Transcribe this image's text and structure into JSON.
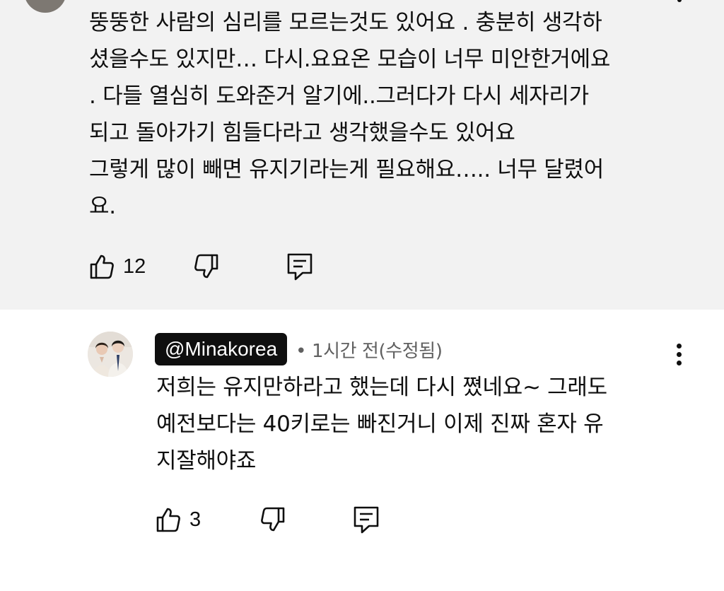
{
  "top_comment": {
    "lines": [
      "뚱뚱한 사람의 심리를 모르는것도 있어요 . 충분히 생각하",
      "셨을수도 있지만… 다시.요요온 모습이 너무 미안한거에요",
      ". 다들 열심히 도와준거 알기에..그러다가 다시 세자리가",
      "되고 돌아가기 힘들다라고 생각했을수도 있어요",
      "그렇게 많이 빼면 유지기라는게 필요해요….. 너무 달렸어",
      "요."
    ],
    "like_count": "12",
    "icons": {
      "like": "thumbs-up-icon",
      "dislike": "thumbs-down-icon",
      "reply": "reply-comment-icon",
      "more": "more-vertical-icon"
    }
  },
  "reply": {
    "handle": "@Minakorea",
    "meta": "• 1시간 전(수정됨)",
    "lines": [
      "저희는 유지만하라고 했는데 다시 쪘네요~ 그래도",
      "예전보다는 40키로는 빠진거니 이제 진짜 혼자 유",
      "지잘해야죠"
    ],
    "like_count": "3",
    "icons": {
      "like": "thumbs-up-icon",
      "dislike": "thumbs-down-icon",
      "reply": "reply-comment-icon",
      "more": "more-vertical-icon"
    }
  },
  "colors": {
    "highlight_background": "#f2f2f2",
    "text": "#0f0f0f",
    "secondary_text": "#606060",
    "handle_chip": "#0f0f0f"
  }
}
